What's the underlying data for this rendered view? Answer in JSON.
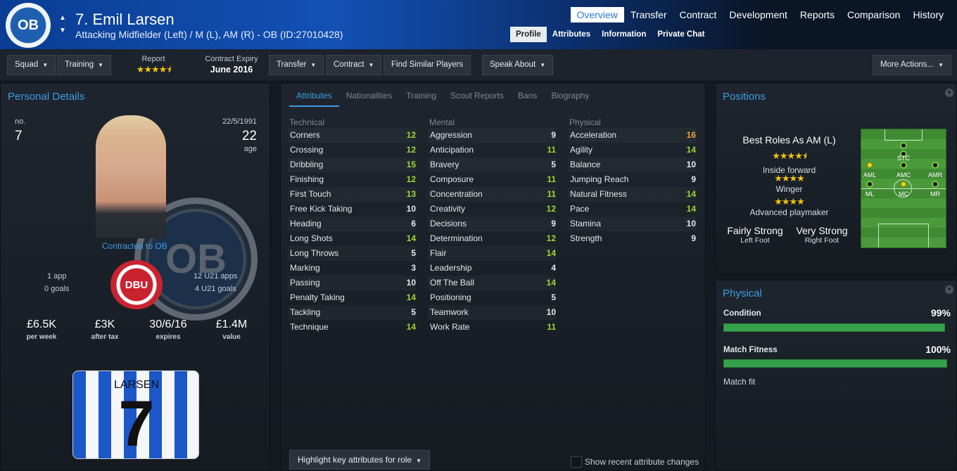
{
  "header": {
    "badge_text": "OB",
    "title": "7. Emil Larsen",
    "subtitle": "Attacking Midfielder (Left) / M (L), AM (R) - OB (ID:27010428)",
    "main_tabs": [
      "Overview",
      "Transfer",
      "Contract",
      "Development",
      "Reports",
      "Comparison",
      "History"
    ],
    "sub_tabs": [
      "Profile",
      "Attributes",
      "Information",
      "Private Chat"
    ]
  },
  "toolbar": {
    "squad": "Squad",
    "training": "Training",
    "report_label": "Report",
    "contract_label": "Contract Expiry",
    "contract_value": "June 2016",
    "transfer": "Transfer",
    "contract": "Contract",
    "find_similar": "Find Similar Players",
    "speak_about": "Speak About",
    "more_actions": "More Actions..."
  },
  "personal": {
    "title": "Personal Details",
    "no_label": "no.",
    "no_value": "7",
    "dob": "22/5/1991",
    "age": "22",
    "age_label": "age",
    "contracted": "Contracted to OB",
    "club_logo": "OB",
    "apps": "1 app",
    "goals": "0 goals",
    "u21_apps": "12 U21 apps",
    "u21_goals": "4 U21 goals",
    "dbu": "DBU",
    "wage": "£6.5K",
    "wage_label": "per week",
    "after_tax": "£3K",
    "after_tax_label": "after tax",
    "expires": "30/6/16",
    "expires_label": "expires",
    "value": "£1.4M",
    "value_label": "value",
    "shirt_name": "LARSEN",
    "shirt_number": "7"
  },
  "attributes": {
    "tabs": [
      "Attributes",
      "Nationalities",
      "Training",
      "Scout Reports",
      "Bans",
      "Biography"
    ],
    "technical_header": "Technical",
    "mental_header": "Mental",
    "physical_header": "Physical",
    "technical": [
      {
        "name": "Corners",
        "value": "12",
        "tone": "vg"
      },
      {
        "name": "Crossing",
        "value": "12",
        "tone": "vg"
      },
      {
        "name": "Dribbling",
        "value": "15",
        "tone": "vg"
      },
      {
        "name": "Finishing",
        "value": "12",
        "tone": "vg"
      },
      {
        "name": "First Touch",
        "value": "13",
        "tone": "vg"
      },
      {
        "name": "Free Kick Taking",
        "value": "10",
        "tone": "vw"
      },
      {
        "name": "Heading",
        "value": "6",
        "tone": "vw"
      },
      {
        "name": "Long Shots",
        "value": "14",
        "tone": "vg"
      },
      {
        "name": "Long Throws",
        "value": "5",
        "tone": "vw"
      },
      {
        "name": "Marking",
        "value": "3",
        "tone": "vw"
      },
      {
        "name": "Passing",
        "value": "10",
        "tone": "vw"
      },
      {
        "name": "Penalty Taking",
        "value": "14",
        "tone": "vg"
      },
      {
        "name": "Tackling",
        "value": "5",
        "tone": "vw"
      },
      {
        "name": "Technique",
        "value": "14",
        "tone": "vg"
      }
    ],
    "mental": [
      {
        "name": "Aggression",
        "value": "9",
        "tone": "vw"
      },
      {
        "name": "Anticipation",
        "value": "11",
        "tone": "vg"
      },
      {
        "name": "Bravery",
        "value": "5",
        "tone": "vw"
      },
      {
        "name": "Composure",
        "value": "11",
        "tone": "vg"
      },
      {
        "name": "Concentration",
        "value": "11",
        "tone": "vg"
      },
      {
        "name": "Creativity",
        "value": "12",
        "tone": "vg"
      },
      {
        "name": "Decisions",
        "value": "9",
        "tone": "vw"
      },
      {
        "name": "Determination",
        "value": "12",
        "tone": "vg"
      },
      {
        "name": "Flair",
        "value": "14",
        "tone": "vg"
      },
      {
        "name": "Leadership",
        "value": "4",
        "tone": "vw"
      },
      {
        "name": "Off The Ball",
        "value": "14",
        "tone": "vg"
      },
      {
        "name": "Positioning",
        "value": "5",
        "tone": "vw"
      },
      {
        "name": "Teamwork",
        "value": "10",
        "tone": "vw"
      },
      {
        "name": "Work Rate",
        "value": "11",
        "tone": "vg"
      }
    ],
    "physical": [
      {
        "name": "Acceleration",
        "value": "16",
        "tone": "vo"
      },
      {
        "name": "Agility",
        "value": "14",
        "tone": "vg"
      },
      {
        "name": "Balance",
        "value": "10",
        "tone": "vw"
      },
      {
        "name": "Jumping Reach",
        "value": "9",
        "tone": "vw"
      },
      {
        "name": "Natural Fitness",
        "value": "14",
        "tone": "vg"
      },
      {
        "name": "Pace",
        "value": "14",
        "tone": "vg"
      },
      {
        "name": "Stamina",
        "value": "10",
        "tone": "vw"
      },
      {
        "name": "Strength",
        "value": "9",
        "tone": "vw"
      }
    ],
    "highlight_button": "Highlight key attributes for role",
    "show_changes": "Show recent attribute changes"
  },
  "positions": {
    "title": "Positions",
    "best_roles": "Best Roles As AM (L)",
    "roles": [
      {
        "name": "Inside forward",
        "stars": "4.5"
      },
      {
        "name": "Winger",
        "stars": "4"
      },
      {
        "name": "Advanced playmaker",
        "stars": "4"
      }
    ],
    "left_foot": "Fairly Strong",
    "left_foot_label": "Left Foot",
    "right_foot": "Very Strong",
    "right_foot_label": "Right Foot",
    "pitch_labels": [
      "STC",
      "AML",
      "AMC",
      "AMR",
      "ML",
      "MC",
      "MR"
    ]
  },
  "physical": {
    "title": "Physical",
    "condition_label": "Condition",
    "condition_value": "99%",
    "condition_fraction": 0.99,
    "fitness_label": "Match Fitness",
    "fitness_value": "100%",
    "fitness_fraction": 1.0,
    "match_fit": "Match fit"
  },
  "colors": {
    "accent": "#3d9ce0",
    "good": "#9ad832",
    "top": "#f0a23a",
    "bar": "#34a24b"
  }
}
